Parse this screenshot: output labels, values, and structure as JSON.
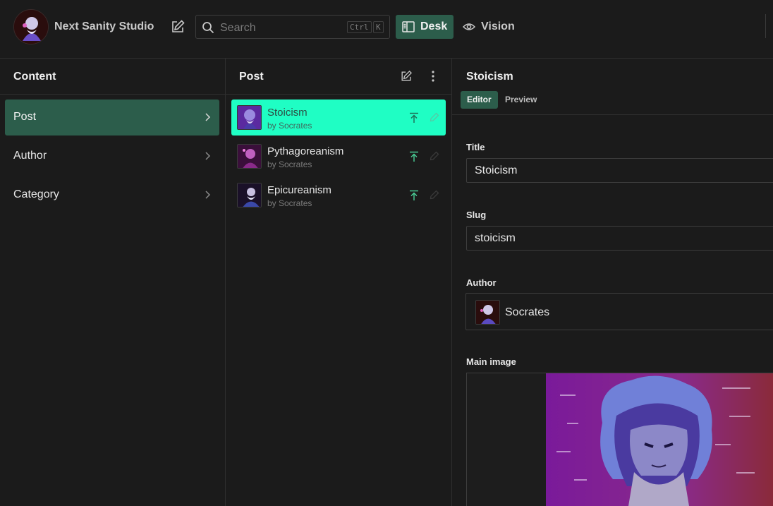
{
  "navbar": {
    "title": "Next Sanity Studio",
    "search_placeholder": "Search",
    "shortcut_ctrl": "Ctrl",
    "shortcut_k": "K",
    "tools": [
      {
        "label": "Desk",
        "active": true,
        "icon": "desk-icon"
      },
      {
        "label": "Vision",
        "active": false,
        "icon": "eye-icon"
      }
    ]
  },
  "content_pane": {
    "title": "Content",
    "items": [
      {
        "label": "Post",
        "active": true
      },
      {
        "label": "Author",
        "active": false
      },
      {
        "label": "Category",
        "active": false
      }
    ]
  },
  "post_pane": {
    "title": "Post",
    "documents": [
      {
        "title": "Stoicism",
        "subtitle": "by Socrates",
        "selected": true
      },
      {
        "title": "Pythagoreanism",
        "subtitle": "by Socrates",
        "selected": false
      },
      {
        "title": "Epicureanism",
        "subtitle": "by Socrates",
        "selected": false
      }
    ]
  },
  "document": {
    "title": "Stoicism",
    "tabs": [
      {
        "label": "Editor",
        "active": true
      },
      {
        "label": "Preview",
        "active": false
      }
    ],
    "fields": {
      "title_label": "Title",
      "title_value": "Stoicism",
      "slug_label": "Slug",
      "slug_value": "stoicism",
      "author_label": "Author",
      "author_value": "Socrates",
      "image_label": "Main image"
    }
  },
  "colors": {
    "accent": "#2c5d4b",
    "selected_item": "#1ffec4",
    "background": "#1b1b1b",
    "publish_green": "#4bd39a"
  }
}
